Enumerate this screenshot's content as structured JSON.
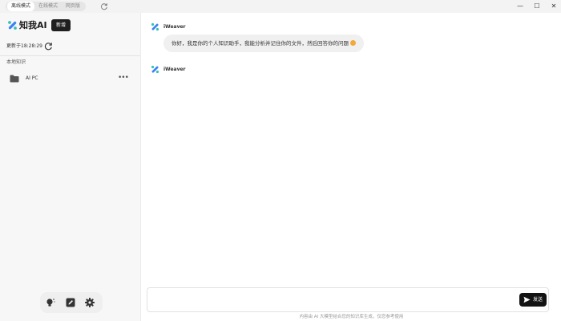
{
  "titlebar": {
    "mode_tabs": [
      "离线模式",
      "在线模式",
      "网页版"
    ],
    "active_mode": "离线模式",
    "window_controls": {
      "minimize": "—",
      "maximize": "☐",
      "close": "✕"
    }
  },
  "sidebar": {
    "brand": "知我AI",
    "new_button": "新增",
    "updated_text": "更新于18:28:29",
    "section_title": "本地知识",
    "folders": [
      {
        "label": "AI PC",
        "icon": "folder-icon",
        "more": "•••"
      }
    ],
    "tools": [
      "lightbulb-icon",
      "edit-icon",
      "gear-icon"
    ]
  },
  "chat": {
    "messages": [
      {
        "sender": "iWeaver",
        "text": "你好，我是你的个人知识助手，我能分析并记住你的文件，然后回答你的问题"
      },
      {
        "sender": "iWeaver",
        "text": ""
      }
    ]
  },
  "composer": {
    "placeholder": "",
    "send_label": "发送",
    "disclaimer": "内容由 AI 大模型结合您的知识库生成，仅您参考使用"
  },
  "colors": {
    "brand_blue": "#3b82f6",
    "brand_teal": "#36c2b4",
    "dark_button": "#1f1f1f",
    "sidebar_bg": "#f7f7f7"
  }
}
